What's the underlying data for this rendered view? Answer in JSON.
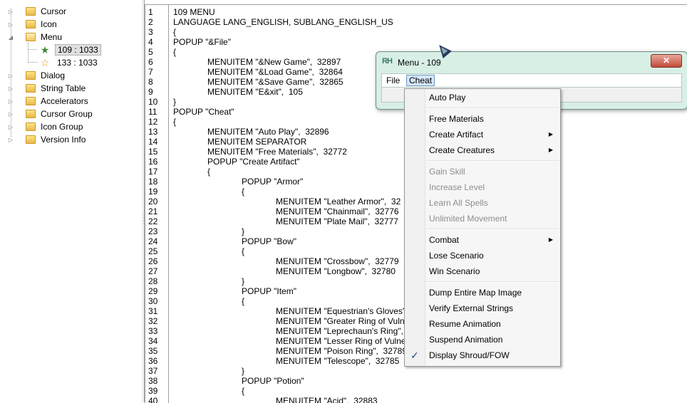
{
  "tree": {
    "items": [
      {
        "label": "Cursor",
        "expanded": false
      },
      {
        "label": "Icon",
        "expanded": false
      },
      {
        "label": "Menu",
        "expanded": true
      },
      {
        "label": "109 : 1033",
        "leaf": true,
        "selected": true
      },
      {
        "label": "133 : 1033",
        "leaf": true
      },
      {
        "label": "Dialog",
        "expanded": false
      },
      {
        "label": "String Table",
        "expanded": false
      },
      {
        "label": "Accelerators",
        "expanded": false
      },
      {
        "label": "Cursor Group",
        "expanded": false
      },
      {
        "label": "Icon Group",
        "expanded": false
      },
      {
        "label": "Version Info",
        "expanded": false
      }
    ]
  },
  "editor": {
    "lines": [
      {
        "n": "1",
        "indent": 0,
        "text": "109 MENU"
      },
      {
        "n": "2",
        "indent": 0,
        "text": "LANGUAGE LANG_ENGLISH, SUBLANG_ENGLISH_US"
      },
      {
        "n": "3",
        "indent": 0,
        "text": "{"
      },
      {
        "n": "4",
        "indent": 0,
        "text": "POPUP \"&File\""
      },
      {
        "n": "5",
        "indent": 0,
        "text": "{"
      },
      {
        "n": "6",
        "indent": 1,
        "text": "MENUITEM \"&New Game\",  32897"
      },
      {
        "n": "7",
        "indent": 1,
        "text": "MENUITEM \"&Load Game\",  32864"
      },
      {
        "n": "8",
        "indent": 1,
        "text": "MENUITEM \"&Save Game\",  32865"
      },
      {
        "n": "9",
        "indent": 1,
        "text": "MENUITEM \"E&xit\",  105"
      },
      {
        "n": "10",
        "indent": 0,
        "text": "}"
      },
      {
        "n": "11",
        "indent": 0,
        "text": "POPUP \"Cheat\""
      },
      {
        "n": "12",
        "indent": 0,
        "text": "{"
      },
      {
        "n": "13",
        "indent": 1,
        "text": "MENUITEM \"Auto Play\",  32896"
      },
      {
        "n": "14",
        "indent": 1,
        "text": "MENUITEM SEPARATOR"
      },
      {
        "n": "15",
        "indent": 1,
        "text": "MENUITEM \"Free Materials\",  32772"
      },
      {
        "n": "16",
        "indent": 1,
        "text": "POPUP \"Create Artifact\""
      },
      {
        "n": "17",
        "indent": 1,
        "text": "{"
      },
      {
        "n": "18",
        "indent": 2,
        "text": "POPUP \"Armor\""
      },
      {
        "n": "19",
        "indent": 2,
        "text": "{"
      },
      {
        "n": "20",
        "indent": 3,
        "text": "MENUITEM \"Leather Armor\",  32"
      },
      {
        "n": "21",
        "indent": 3,
        "text": "MENUITEM \"Chainmail\",  32776"
      },
      {
        "n": "22",
        "indent": 3,
        "text": "MENUITEM \"Plate Mail\",  32777"
      },
      {
        "n": "23",
        "indent": 2,
        "text": "}"
      },
      {
        "n": "24",
        "indent": 2,
        "text": "POPUP \"Bow\""
      },
      {
        "n": "25",
        "indent": 2,
        "text": "{"
      },
      {
        "n": "26",
        "indent": 3,
        "text": "MENUITEM \"Crossbow\",  32779"
      },
      {
        "n": "27",
        "indent": 3,
        "text": "MENUITEM \"Longbow\",  32780"
      },
      {
        "n": "28",
        "indent": 2,
        "text": "}"
      },
      {
        "n": "29",
        "indent": 2,
        "text": "POPUP \"Item\""
      },
      {
        "n": "30",
        "indent": 2,
        "text": "{"
      },
      {
        "n": "31",
        "indent": 3,
        "text": "MENUITEM \"Equestrian's Gloves\","
      },
      {
        "n": "32",
        "indent": 3,
        "text": "MENUITEM \"Greater Ring of Vuln"
      },
      {
        "n": "33",
        "indent": 3,
        "text": "MENUITEM \"Leprechaun's Ring\","
      },
      {
        "n": "34",
        "indent": 3,
        "text": "MENUITEM \"Lesser Ring of Vulne"
      },
      {
        "n": "35",
        "indent": 3,
        "text": "MENUITEM \"Poison Ring\",  32789"
      },
      {
        "n": "36",
        "indent": 3,
        "text": "MENUITEM \"Telescope\",  32785"
      },
      {
        "n": "37",
        "indent": 2,
        "text": "}"
      },
      {
        "n": "38",
        "indent": 2,
        "text": "POPUP \"Potion\""
      },
      {
        "n": "39",
        "indent": 2,
        "text": "{"
      },
      {
        "n": "40",
        "indent": 3,
        "text": "MENUITEM \"Acid\",  32883"
      }
    ]
  },
  "preview_window": {
    "logo": "RH",
    "title": "Menu -  109",
    "close_label": "✕",
    "menubar": [
      "File",
      "Cheat"
    ]
  },
  "dropdown": {
    "items": [
      {
        "label": "Auto Play"
      },
      {
        "separator": true
      },
      {
        "label": "Free Materials"
      },
      {
        "label": "Create Artifact",
        "submenu": true
      },
      {
        "label": "Create Creatures",
        "submenu": true
      },
      {
        "separator": true
      },
      {
        "label": "Gain Skill",
        "disabled": true
      },
      {
        "label": "Increase Level",
        "disabled": true
      },
      {
        "label": "Learn All Spells",
        "disabled": true
      },
      {
        "label": "Unlimited Movement",
        "disabled": true
      },
      {
        "separator": true
      },
      {
        "label": "Combat",
        "submenu": true
      },
      {
        "label": "Lose Scenario"
      },
      {
        "label": "Win Scenario"
      },
      {
        "separator": true
      },
      {
        "label": "Dump Entire Map Image"
      },
      {
        "label": "Verify External Strings"
      },
      {
        "label": "Resume Animation"
      },
      {
        "label": "Suspend Animation"
      },
      {
        "label": "Display Shroud/FOW",
        "checked": true
      }
    ]
  },
  "icons": {
    "folder": "folder-icon",
    "leaf_selected": "green-star-icon",
    "leaf": "star-icon",
    "submenu": "chevron-right-icon",
    "check": "checkmark-icon"
  }
}
